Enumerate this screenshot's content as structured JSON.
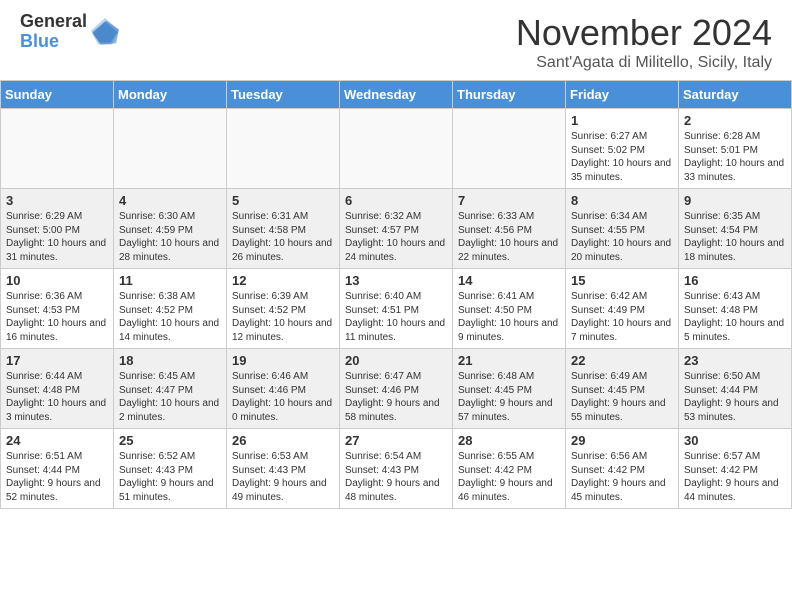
{
  "logo": {
    "general": "General",
    "blue": "Blue"
  },
  "title": "November 2024",
  "location": "Sant'Agata di Militello, Sicily, Italy",
  "days_of_week": [
    "Sunday",
    "Monday",
    "Tuesday",
    "Wednesday",
    "Thursday",
    "Friday",
    "Saturday"
  ],
  "weeks": [
    [
      {
        "day": "",
        "info": "",
        "empty": true
      },
      {
        "day": "",
        "info": "",
        "empty": true
      },
      {
        "day": "",
        "info": "",
        "empty": true
      },
      {
        "day": "",
        "info": "",
        "empty": true
      },
      {
        "day": "",
        "info": "",
        "empty": true
      },
      {
        "day": "1",
        "info": "Sunrise: 6:27 AM\nSunset: 5:02 PM\nDaylight: 10 hours and 35 minutes."
      },
      {
        "day": "2",
        "info": "Sunrise: 6:28 AM\nSunset: 5:01 PM\nDaylight: 10 hours and 33 minutes."
      }
    ],
    [
      {
        "day": "3",
        "info": "Sunrise: 6:29 AM\nSunset: 5:00 PM\nDaylight: 10 hours and 31 minutes."
      },
      {
        "day": "4",
        "info": "Sunrise: 6:30 AM\nSunset: 4:59 PM\nDaylight: 10 hours and 28 minutes."
      },
      {
        "day": "5",
        "info": "Sunrise: 6:31 AM\nSunset: 4:58 PM\nDaylight: 10 hours and 26 minutes."
      },
      {
        "day": "6",
        "info": "Sunrise: 6:32 AM\nSunset: 4:57 PM\nDaylight: 10 hours and 24 minutes."
      },
      {
        "day": "7",
        "info": "Sunrise: 6:33 AM\nSunset: 4:56 PM\nDaylight: 10 hours and 22 minutes."
      },
      {
        "day": "8",
        "info": "Sunrise: 6:34 AM\nSunset: 4:55 PM\nDaylight: 10 hours and 20 minutes."
      },
      {
        "day": "9",
        "info": "Sunrise: 6:35 AM\nSunset: 4:54 PM\nDaylight: 10 hours and 18 minutes."
      }
    ],
    [
      {
        "day": "10",
        "info": "Sunrise: 6:36 AM\nSunset: 4:53 PM\nDaylight: 10 hours and 16 minutes."
      },
      {
        "day": "11",
        "info": "Sunrise: 6:38 AM\nSunset: 4:52 PM\nDaylight: 10 hours and 14 minutes."
      },
      {
        "day": "12",
        "info": "Sunrise: 6:39 AM\nSunset: 4:52 PM\nDaylight: 10 hours and 12 minutes."
      },
      {
        "day": "13",
        "info": "Sunrise: 6:40 AM\nSunset: 4:51 PM\nDaylight: 10 hours and 11 minutes."
      },
      {
        "day": "14",
        "info": "Sunrise: 6:41 AM\nSunset: 4:50 PM\nDaylight: 10 hours and 9 minutes."
      },
      {
        "day": "15",
        "info": "Sunrise: 6:42 AM\nSunset: 4:49 PM\nDaylight: 10 hours and 7 minutes."
      },
      {
        "day": "16",
        "info": "Sunrise: 6:43 AM\nSunset: 4:48 PM\nDaylight: 10 hours and 5 minutes."
      }
    ],
    [
      {
        "day": "17",
        "info": "Sunrise: 6:44 AM\nSunset: 4:48 PM\nDaylight: 10 hours and 3 minutes."
      },
      {
        "day": "18",
        "info": "Sunrise: 6:45 AM\nSunset: 4:47 PM\nDaylight: 10 hours and 2 minutes."
      },
      {
        "day": "19",
        "info": "Sunrise: 6:46 AM\nSunset: 4:46 PM\nDaylight: 10 hours and 0 minutes."
      },
      {
        "day": "20",
        "info": "Sunrise: 6:47 AM\nSunset: 4:46 PM\nDaylight: 9 hours and 58 minutes."
      },
      {
        "day": "21",
        "info": "Sunrise: 6:48 AM\nSunset: 4:45 PM\nDaylight: 9 hours and 57 minutes."
      },
      {
        "day": "22",
        "info": "Sunrise: 6:49 AM\nSunset: 4:45 PM\nDaylight: 9 hours and 55 minutes."
      },
      {
        "day": "23",
        "info": "Sunrise: 6:50 AM\nSunset: 4:44 PM\nDaylight: 9 hours and 53 minutes."
      }
    ],
    [
      {
        "day": "24",
        "info": "Sunrise: 6:51 AM\nSunset: 4:44 PM\nDaylight: 9 hours and 52 minutes."
      },
      {
        "day": "25",
        "info": "Sunrise: 6:52 AM\nSunset: 4:43 PM\nDaylight: 9 hours and 51 minutes."
      },
      {
        "day": "26",
        "info": "Sunrise: 6:53 AM\nSunset: 4:43 PM\nDaylight: 9 hours and 49 minutes."
      },
      {
        "day": "27",
        "info": "Sunrise: 6:54 AM\nSunset: 4:43 PM\nDaylight: 9 hours and 48 minutes."
      },
      {
        "day": "28",
        "info": "Sunrise: 6:55 AM\nSunset: 4:42 PM\nDaylight: 9 hours and 46 minutes."
      },
      {
        "day": "29",
        "info": "Sunrise: 6:56 AM\nSunset: 4:42 PM\nDaylight: 9 hours and 45 minutes."
      },
      {
        "day": "30",
        "info": "Sunrise: 6:57 AM\nSunset: 4:42 PM\nDaylight: 9 hours and 44 minutes."
      }
    ]
  ]
}
